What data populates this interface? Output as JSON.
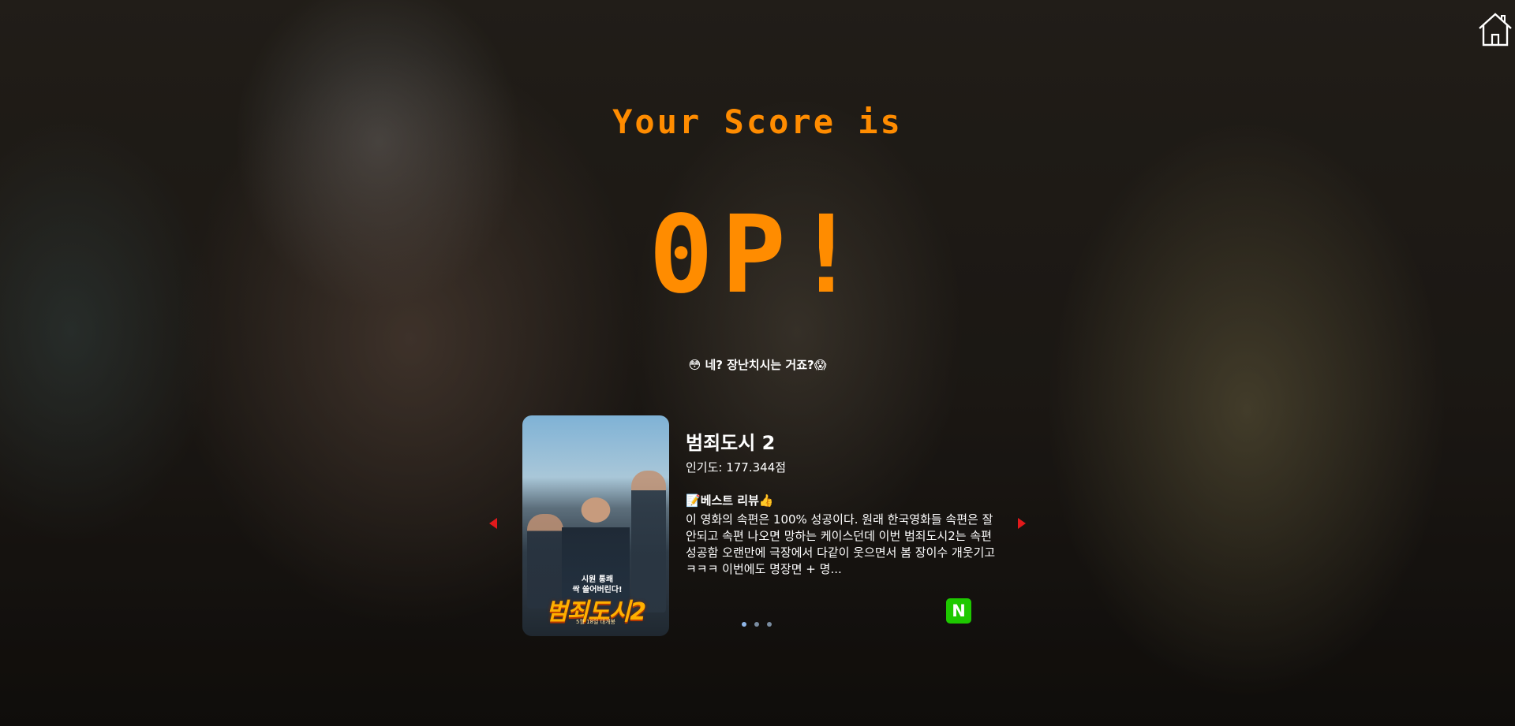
{
  "header": {
    "home_icon": "home-icon"
  },
  "result": {
    "title": "Your Score is",
    "score": "0P!",
    "message": "😳 네? 장난치시는 거죠?😱"
  },
  "recommendation": {
    "movie_title": "범죄도시 2",
    "popularity_label": "인기도: 177.344점",
    "poster": {
      "tagline": "시원 통쾌\n싹 쓸어버린다!",
      "title": "범죄도시2",
      "date": "5월 18일 대개봉"
    },
    "best_review_label": "베스트 리뷰",
    "best_review_icon_left": "📝",
    "best_review_icon_right": "👍",
    "review_text": "이 영화의 속편은 100% 성공이다. 원래 한국영화들 속편은 잘 안되고 속편 나오면 망하는 케이스던데 이번 범죄도시2는 속편 성공함 오랜만에 극장에서 다같이 웃으면서 봄 장이수 개웃기고 ㅋㅋㅋ 이번에도 명장면 + 명...",
    "source_badge": "N",
    "pagination_count": 3,
    "active_page": 1
  },
  "colors": {
    "accent": "#ff8c00",
    "arrow": "#e1191b",
    "naver": "#1ec800"
  }
}
